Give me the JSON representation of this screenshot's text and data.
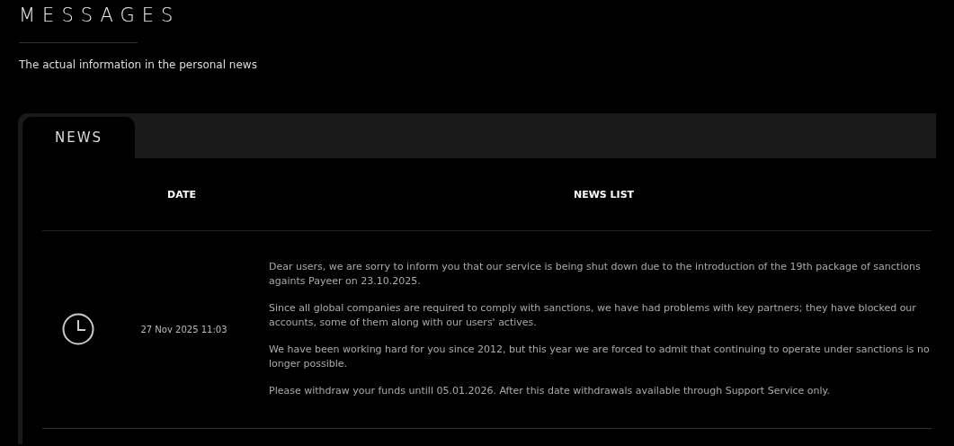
{
  "page": {
    "title": "MESSAGES",
    "subtitle": "The actual information in the personal news"
  },
  "tabs": [
    {
      "label": "NEWS",
      "selected": true
    }
  ],
  "table": {
    "columns": [
      "DATE",
      "NEWS LIST"
    ],
    "rows": [
      {
        "date": "27 Nov 2025 11:03",
        "paragraphs": [
          "Dear users, we are sorry to inform you that our service is being shut down due to the introduction of the 19th package of sanctions againts Payeer on 23.10.2025.",
          "Since all global companies are required to comply with sanctions, we have had problems with key partners; they have blocked our accounts, some of them along with our users' actives.",
          "We have been working hard for you since 2012, but this year we are forced to admit that continuing to operate under sanctions is no longer possible.",
          "Please withdraw your funds untill 05.01.2026. After this date withdrawals available through Support Service only."
        ]
      }
    ]
  }
}
